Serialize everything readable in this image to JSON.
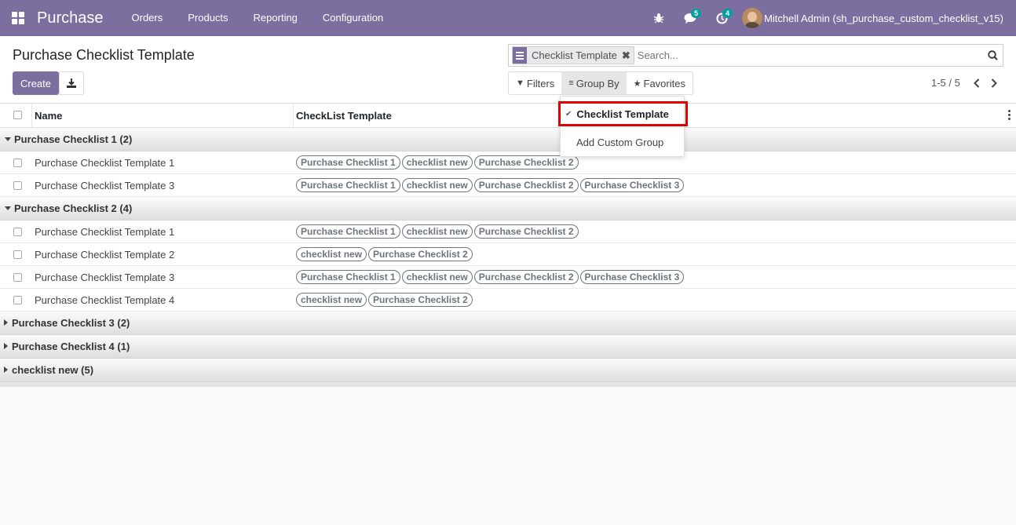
{
  "navbar": {
    "brand": "Purchase",
    "menu": [
      "Orders",
      "Products",
      "Reporting",
      "Configuration"
    ],
    "messages_count": "5",
    "activities_count": "4",
    "user": "Mitchell Admin (sh_purchase_custom_checklist_v15)"
  },
  "control": {
    "title": "Purchase Checklist Template",
    "create_label": "Create",
    "search_facet": "Checklist Template",
    "search_placeholder": "Search...",
    "filters_label": "Filters",
    "groupby_label": "Group By",
    "favorites_label": "Favorites",
    "pager": "1-5 / 5"
  },
  "groupby_dropdown": {
    "selected": "Checklist Template",
    "custom": "Add Custom Group"
  },
  "table": {
    "headers": {
      "name": "Name",
      "template": "CheckList Template"
    },
    "groups": [
      {
        "label": "Purchase Checklist 1 (2)",
        "open": true,
        "rows": [
          {
            "name": "Purchase Checklist Template 1",
            "tags": [
              "Purchase Checklist 1",
              "checklist new",
              "Purchase Checklist 2"
            ]
          },
          {
            "name": "Purchase Checklist Template 3",
            "tags": [
              "Purchase Checklist 1",
              "checklist new",
              "Purchase Checklist 2",
              "Purchase Checklist 3"
            ]
          }
        ]
      },
      {
        "label": "Purchase Checklist 2 (4)",
        "open": true,
        "rows": [
          {
            "name": "Purchase Checklist Template 1",
            "tags": [
              "Purchase Checklist 1",
              "checklist new",
              "Purchase Checklist 2"
            ]
          },
          {
            "name": "Purchase Checklist Template 2",
            "tags": [
              "checklist new",
              "Purchase Checklist 2"
            ]
          },
          {
            "name": "Purchase Checklist Template 3",
            "tags": [
              "Purchase Checklist 1",
              "checklist new",
              "Purchase Checklist 2",
              "Purchase Checklist 3"
            ]
          },
          {
            "name": "Purchase Checklist Template 4",
            "tags": [
              "checklist new",
              "Purchase Checklist 2"
            ]
          }
        ]
      },
      {
        "label": "Purchase Checklist 3 (2)",
        "open": false,
        "rows": []
      },
      {
        "label": "Purchase Checklist 4 (1)",
        "open": false,
        "rows": []
      },
      {
        "label": "checklist new (5)",
        "open": false,
        "rows": []
      }
    ]
  },
  "colors": {
    "brand": "#7c6e9f",
    "highlight": "#e50000",
    "badge": "#00a09d"
  }
}
